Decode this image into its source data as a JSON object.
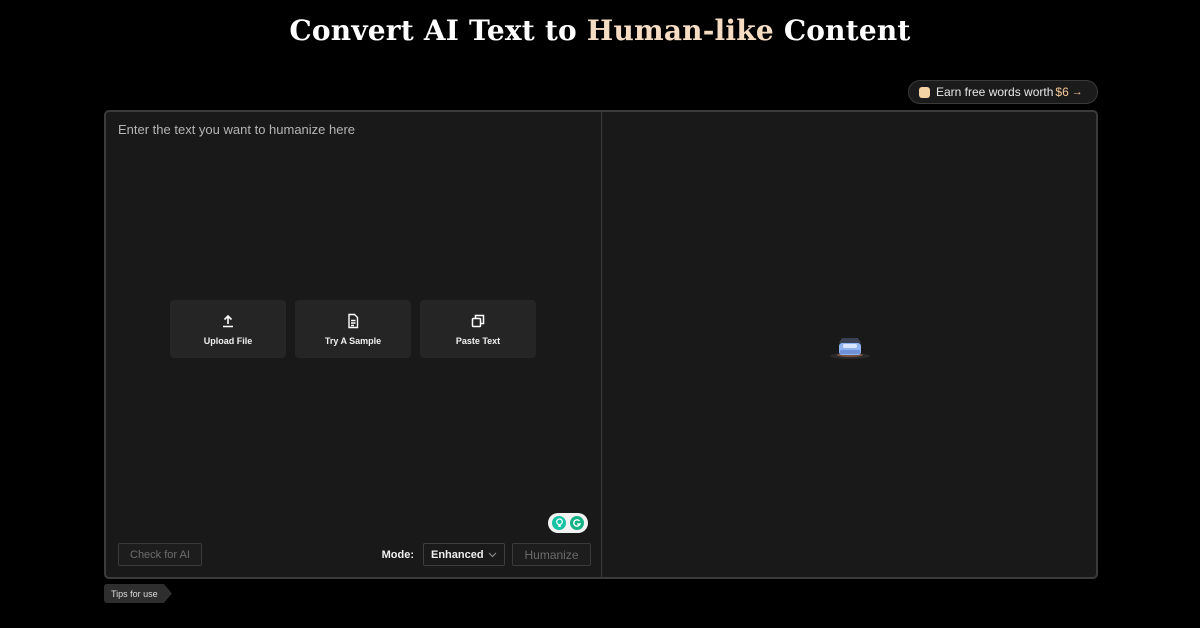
{
  "hero": {
    "title_before": "Convert AI Text to",
    "title_accent": "Human-like",
    "title_after": "Content"
  },
  "earn_pill": {
    "text": "Earn free words worth",
    "amount": "$6",
    "arrow": "→",
    "icon": "gift-icon"
  },
  "editor": {
    "placeholder": "Enter the text you want to humanize here",
    "actions": [
      {
        "label": "Upload File",
        "icon": "upload-icon"
      },
      {
        "label": "Try A Sample",
        "icon": "document-icon"
      },
      {
        "label": "Paste Text",
        "icon": "copy-icon"
      }
    ],
    "check_ai_label": "Check for AI",
    "mode_label": "Mode:",
    "mode_value": "Enhanced",
    "humanize_label": "Humanize"
  },
  "output": {
    "loader_icon": "loader-icon"
  },
  "tips": {
    "label": "Tips for use"
  },
  "colors": {
    "accent": "#f6dcc3",
    "background": "#000000",
    "panel": "#191919"
  }
}
